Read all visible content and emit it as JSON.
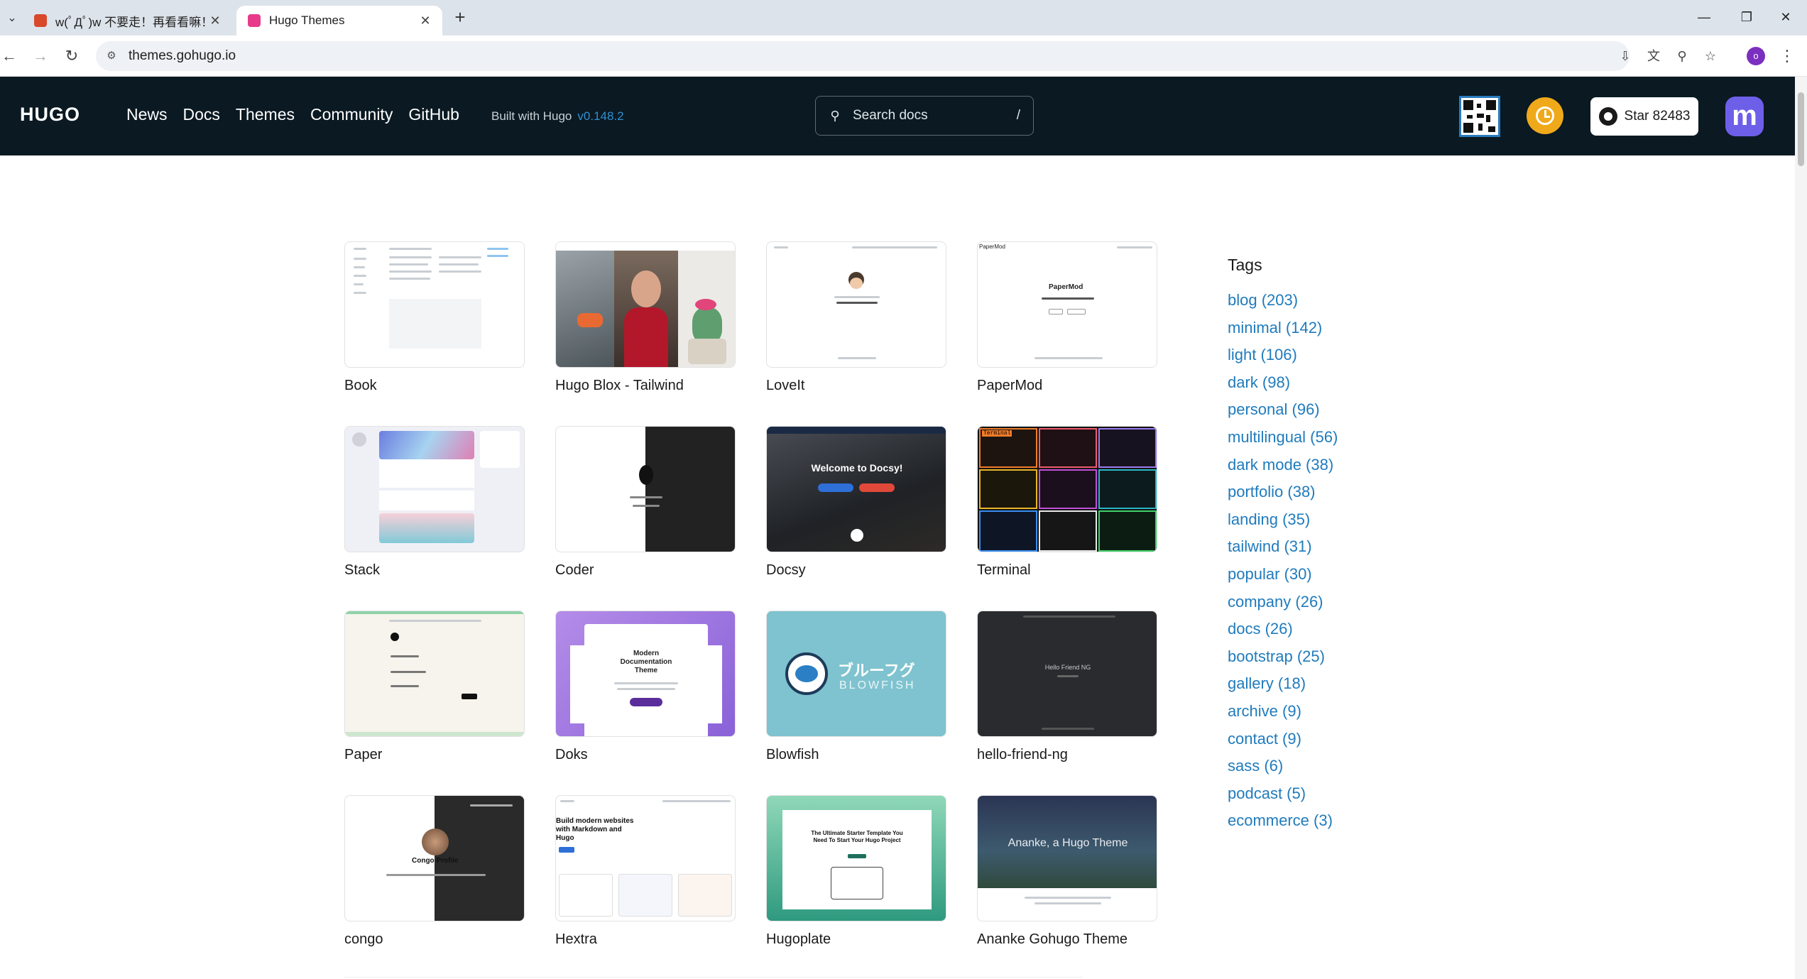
{
  "browser": {
    "tabs": [
      {
        "title": "w(ﾟДﾟ)w 不要走！再看看嘛！",
        "active": false
      },
      {
        "title": "Hugo Themes",
        "active": true
      }
    ],
    "url": "themes.gohugo.io",
    "profile_initial": "o"
  },
  "header": {
    "logo": "HUGO",
    "nav": [
      "News",
      "Docs",
      "Themes",
      "Community",
      "GitHub"
    ],
    "built_with": "Built with Hugo",
    "version": "v0.148.2",
    "search_placeholder": "Search docs",
    "search_shortcut": "/",
    "star_label": "Star 82483",
    "accent_color": "#f0a91a",
    "mastodon_glyph": "m"
  },
  "themes": [
    {
      "name": "Book"
    },
    {
      "name": "Hugo Blox - Tailwind"
    },
    {
      "name": "LoveIt"
    },
    {
      "name": "PaperMod"
    },
    {
      "name": "Stack"
    },
    {
      "name": "Coder"
    },
    {
      "name": "Docsy"
    },
    {
      "name": "Terminal"
    },
    {
      "name": "Paper"
    },
    {
      "name": "Doks"
    },
    {
      "name": "Blowfish"
    },
    {
      "name": "hello-friend-ng"
    },
    {
      "name": "congo"
    },
    {
      "name": "Hextra"
    },
    {
      "name": "Hugoplate"
    },
    {
      "name": "Ananke Gohugo Theme"
    }
  ],
  "thumb_text": {
    "papermod_title": "PaperMod",
    "docsy_title": "Welcome to Docsy!",
    "doks_title": "Modern Documentation Theme",
    "blowfish_jp": "ブルーフグ",
    "blowfish_en": "BLOWFISH",
    "hello_friend": "Hello Friend NG",
    "congo_profile": "Congo Profile",
    "hextra_title": "Build modern websites with Markdown and Hugo",
    "hugoplate_title": "The Ultimate Starter Template You Need To Start Your Hugo Project",
    "ananke_title": "Ananke, a Hugo Theme",
    "terminal_label": "Terminal"
  },
  "tags": {
    "title": "Tags",
    "items": [
      "blog (203)",
      "minimal (142)",
      "light (106)",
      "dark (98)",
      "personal (96)",
      "multilingual (56)",
      "dark mode (38)",
      "portfolio (38)",
      "landing (35)",
      "tailwind (31)",
      "popular (30)",
      "company (26)",
      "docs (26)",
      "bootstrap (25)",
      "gallery (18)",
      "archive (9)",
      "contact (9)",
      "sass (6)",
      "podcast (5)",
      "ecommerce (3)"
    ]
  }
}
